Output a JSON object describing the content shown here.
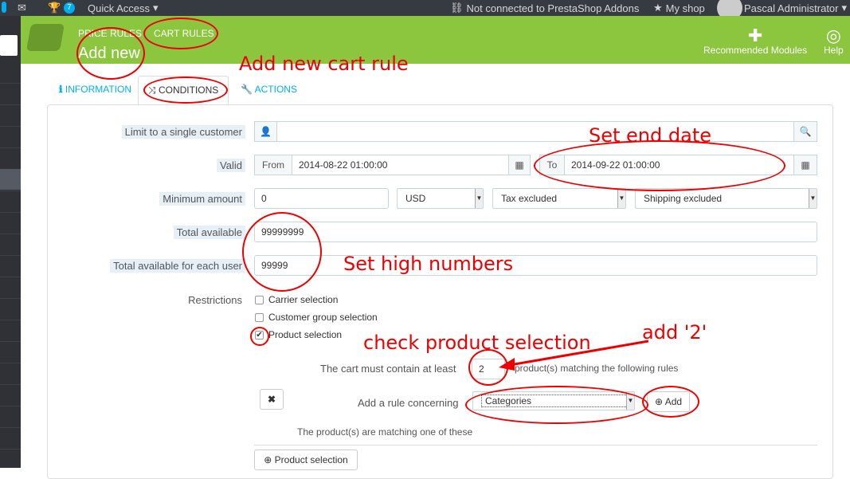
{
  "topbar": {
    "badge_count": "7",
    "quick_access": "Quick Access",
    "addons_status": "Not connected to PrestaShop Addons",
    "my_shop": "My shop",
    "user_name": "Pascal Administrator"
  },
  "header": {
    "breadcrumb_1": "PRICE RULES",
    "breadcrumb_2": "CART RULES",
    "page_title": "Add new",
    "recommended_modules": "Recommended Modules",
    "help": "Help"
  },
  "tabs": [
    {
      "label": "INFORMATION",
      "icon": "info-icon"
    },
    {
      "label": "CONDITIONS",
      "icon": "shuffle-icon"
    },
    {
      "label": "ACTIONS",
      "icon": "wrench-icon"
    }
  ],
  "form": {
    "limit_customer_label": "Limit to a single customer",
    "limit_customer_value": "",
    "valid_label": "Valid",
    "from_label": "From",
    "from_value": "2014-08-22 01:00:00",
    "to_label": "To",
    "to_value": "2014-09-22 01:00:00",
    "min_amount_label": "Minimum amount",
    "min_amount_value": "0",
    "currency": "USD",
    "tax": "Tax excluded",
    "shipping": "Shipping excluded",
    "total_available_label": "Total available",
    "total_available_value": "99999999",
    "total_each_user_label": "Total available for each user",
    "total_each_user_value": "99999",
    "restrictions_label": "Restrictions",
    "carrier_selection": "Carrier selection",
    "customer_group_selection": "Customer group selection",
    "product_selection": "Product selection",
    "cart_must_contain": "The cart must contain at least",
    "cart_quantity": "2",
    "matching_rules": "product(s) matching the following rules",
    "rule_concerning_label": "Add a rule concerning",
    "rule_concerning_value": "Categories",
    "add_button": "Add",
    "matching_one": "The product(s) are matching one of these",
    "product_selection_button": "Product selection"
  },
  "annotations": {
    "add_new_cart_rule": "Add new cart rule",
    "set_end_date": "Set end date",
    "set_high_numbers": "Set high numbers",
    "check_product_selection": "check product selection",
    "add_2": "add '2'"
  },
  "colors": {
    "accent": "#8bc63e",
    "link": "#00aff0",
    "annotation": "#e00000"
  }
}
